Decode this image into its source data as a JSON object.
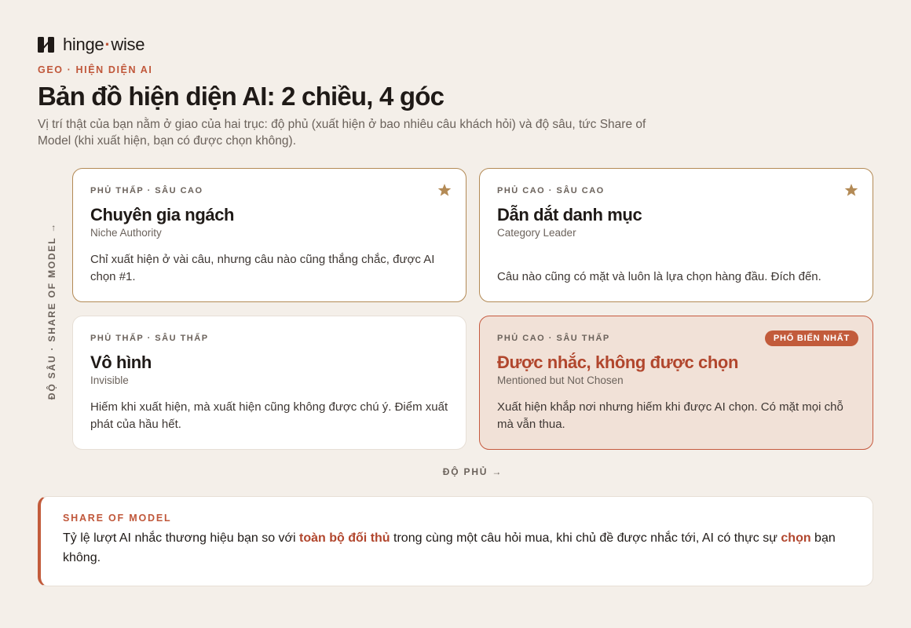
{
  "brand": {
    "name_left": "hinge",
    "name_sep": "·",
    "name_right": "wise",
    "accent": "#c0573a"
  },
  "header": {
    "eyebrow": "GEO · HIỆN DIỆN AI",
    "title": "Bản đồ hiện diện AI: 2 chiều, 4 góc",
    "subtitle": "Vị trí thật của bạn nằm ở giao của hai trục: độ phủ (xuất hiện ở bao nhiêu câu khách hỏi) và độ sâu, tức Share of Model (khi xuất hiện, bạn có được chọn không)."
  },
  "axes": {
    "y_label": "ĐỘ SÂU · SHARE OF MODEL →",
    "x_label": "ĐỘ PHỦ →"
  },
  "quadrants": [
    {
      "label": "PHỦ THẤP · SÂU CAO",
      "title": "Chuyên gia ngách",
      "subtitle": "Niche Authority",
      "desc": "Chỉ xuất hiện ở vài câu, nhưng câu nào cũng thắng chắc, được AI chọn #1.",
      "icon": "star-icon"
    },
    {
      "label": "PHỦ CAO · SÂU CAO",
      "title": "Dẫn dắt danh mục",
      "subtitle": "Category Leader",
      "desc": "Câu nào cũng có mặt và luôn là lựa chọn hàng đầu. Đích đến.",
      "icon": "star-icon"
    },
    {
      "label": "PHỦ THẤP · SÂU THẤP",
      "title": "Vô hình",
      "subtitle": "Invisible",
      "desc": "Hiếm khi xuất hiện, mà xuất hiện cũng không được chú ý. Điểm xuất phát của hầu hết."
    },
    {
      "label": "PHỦ CAO · SÂU THẤP",
      "title": "Được nhắc, không được chọn",
      "subtitle": "Mentioned but Not Chosen",
      "desc": "Xuất hiện khắp nơi nhưng hiếm khi được AI chọn. Có mặt mọi chỗ mà vẫn thua.",
      "badge": "PHỔ BIẾN NHẤT"
    }
  ],
  "callout": {
    "label": "SHARE OF MODEL",
    "text_1": "Tỷ lệ lượt AI nhắc thương hiệu bạn so với ",
    "highlight_1": "toàn bộ đối thủ",
    "text_2": " trong cùng một câu hỏi mua, khi chủ đề được nhắc tới, AI có thực sự ",
    "highlight_2": "chọn",
    "text_3": " bạn không."
  },
  "colors": {
    "background": "#f4efe9",
    "accent": "#c25b3b",
    "gold": "#b38a55",
    "highlight_bg": "#f1e1d7"
  }
}
